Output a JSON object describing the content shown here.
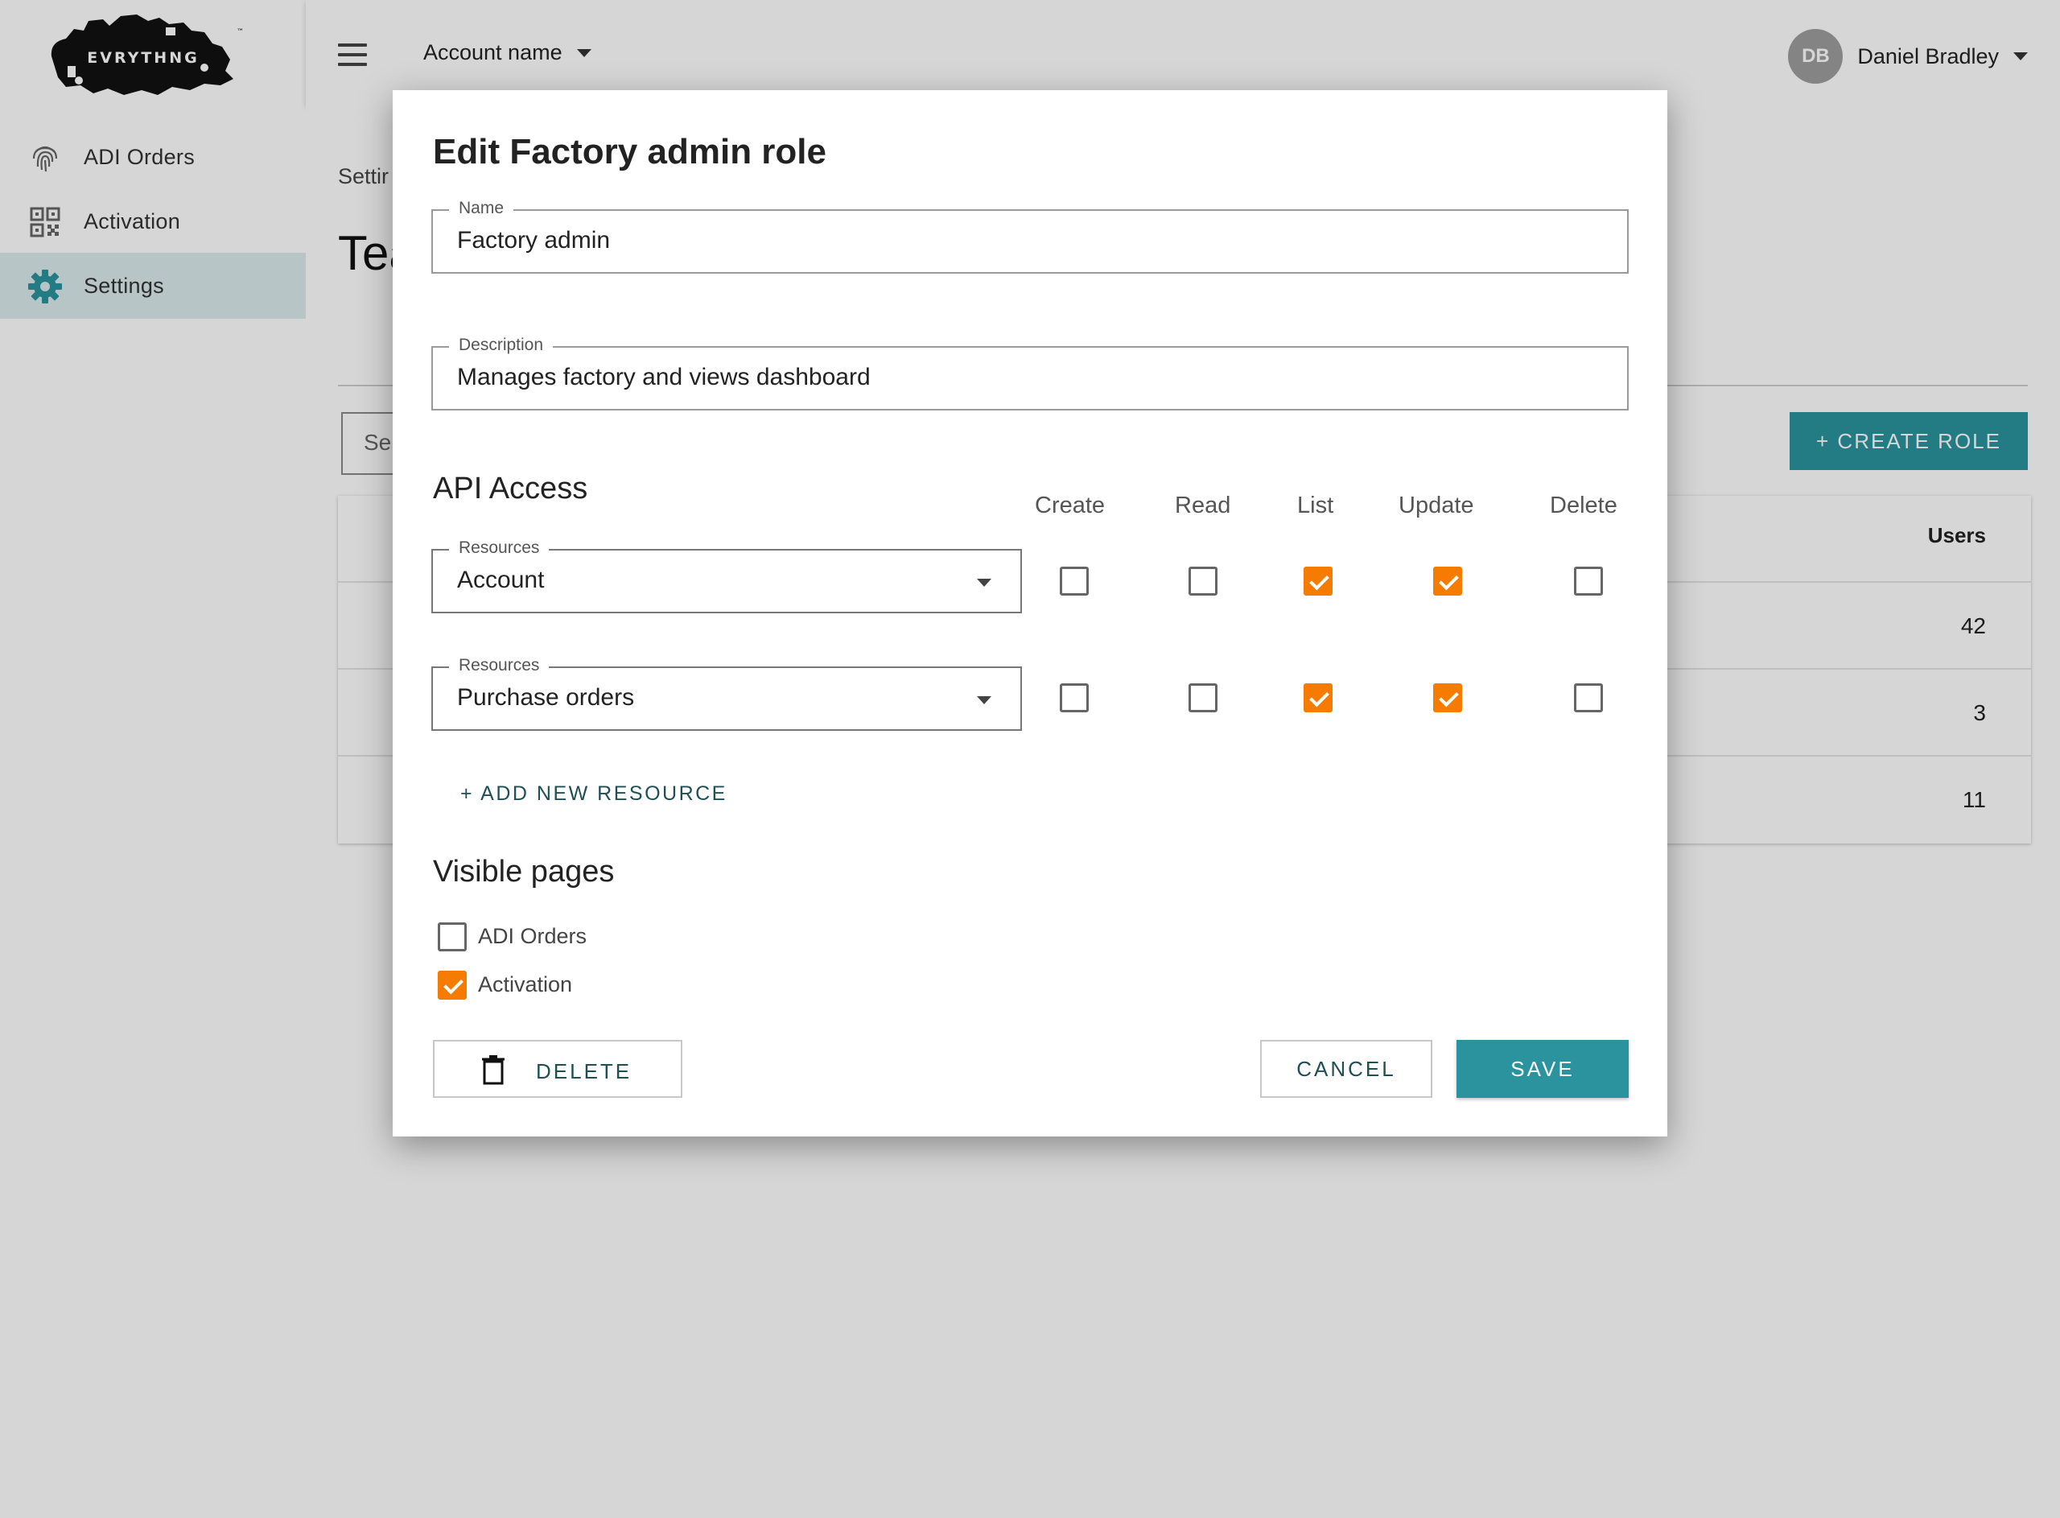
{
  "brand": {
    "logo_text": "EVRYTHNG",
    "accent": "#2a939e",
    "check": "#f57c00"
  },
  "sidebar": {
    "items": [
      {
        "label": "ADI Orders",
        "icon": "fingerprint-icon"
      },
      {
        "label": "Activation",
        "icon": "qr-code-icon"
      },
      {
        "label": "Settings",
        "icon": "gear-icon",
        "active": true
      }
    ]
  },
  "topbar": {
    "account_label": "Account name",
    "user": {
      "initials": "DB",
      "name": "Daniel Bradley"
    }
  },
  "background": {
    "crumb": "Settir",
    "title": "Tea",
    "search_placeholder": "Se",
    "create_role_label": "+ CREATE ROLE",
    "table": {
      "header": "Users",
      "rows": [
        "42",
        "3",
        "11"
      ]
    }
  },
  "modal": {
    "title": "Edit Factory admin role",
    "name": {
      "label": "Name",
      "value": "Factory admin"
    },
    "description": {
      "label": "Description",
      "value": "Manages factory and views dashboard"
    },
    "api_access": {
      "title": "API Access",
      "columns": [
        "Create",
        "Read",
        "List",
        "Update",
        "Delete"
      ],
      "resources": [
        {
          "label": "Resources",
          "value": "Account",
          "perms": [
            false,
            false,
            true,
            true,
            false
          ]
        },
        {
          "label": "Resources",
          "value": "Purchase orders",
          "perms": [
            false,
            false,
            true,
            true,
            false
          ]
        }
      ],
      "add_label": "+ ADD NEW RESOURCE"
    },
    "visible_pages": {
      "title": "Visible pages",
      "items": [
        {
          "label": "ADI Orders",
          "checked": false
        },
        {
          "label": "Activation",
          "checked": true
        }
      ]
    },
    "buttons": {
      "delete": "DELETE",
      "cancel": "CANCEL",
      "save": "SAVE"
    }
  }
}
